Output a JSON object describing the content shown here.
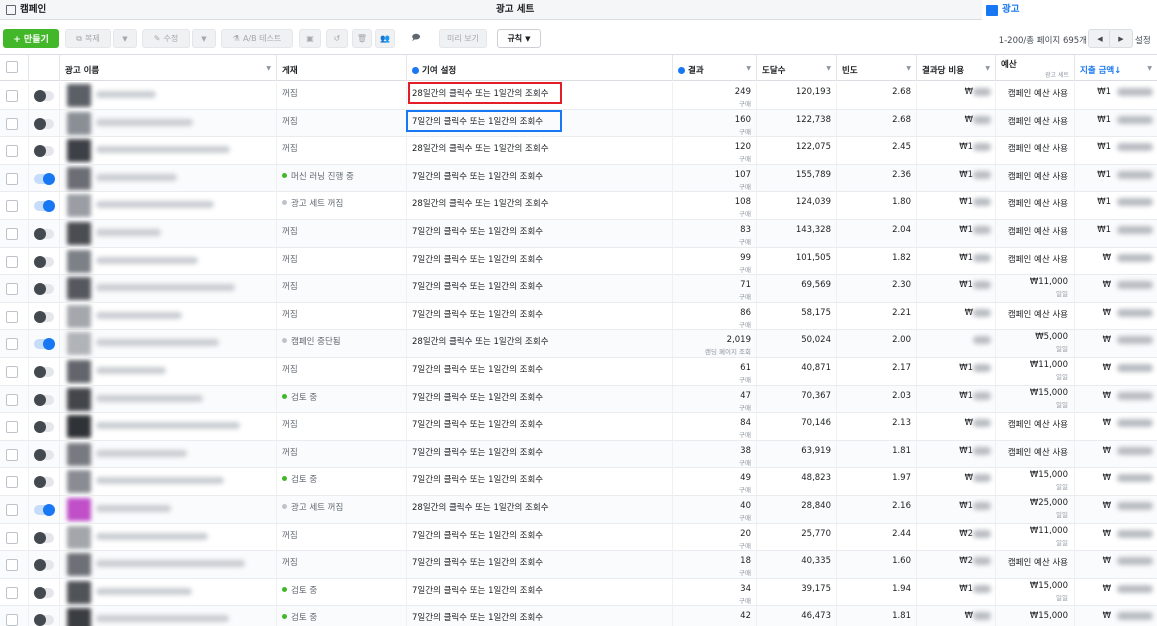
{
  "tabs": {
    "campaign": "캠페인",
    "adset": "광고 세트",
    "ad": "광고"
  },
  "toolbar": {
    "create": "+ 만들기",
    "duplicate": "복제",
    "edit": "수정",
    "ab_test": "A/B 테스트",
    "preview": "미리 보기",
    "rules": "규칙",
    "pagination": "1-200/총 페이지 695개",
    "settings": "설정"
  },
  "columns": {
    "ad_name": "광고 이름",
    "delivery": "게재",
    "attribution": "기여 설정",
    "results": "결과",
    "reach": "도달수",
    "frequency": "빈도",
    "cost_per_result": "결과당 비용",
    "budget": "예산",
    "budget_sub": "광고 세트",
    "amount_spent": "지출 금액"
  },
  "rows": [
    {
      "delivery": "꺼짐",
      "status_dot": "",
      "attribution": "28일간의 클릭수 또는 1일간의 조회수",
      "results": "249",
      "result_type": "구매",
      "reach": "120,193",
      "frequency": "2.68",
      "cpr": "₩",
      "budget": "캠페인 예산 사용",
      "budget_sub": "",
      "spent": "₩1",
      "toggle": "off",
      "thumb": "#5b5f66"
    },
    {
      "delivery": "꺼짐",
      "status_dot": "",
      "attribution": "7일간의 클릭수 또는 1일간의 조회수",
      "results": "160",
      "result_type": "구매",
      "reach": "122,738",
      "frequency": "2.68",
      "cpr": "₩",
      "budget": "캠페인 예산 사용",
      "budget_sub": "",
      "spent": "₩1",
      "toggle": "off",
      "thumb": "#8a8f96"
    },
    {
      "delivery": "꺼짐",
      "status_dot": "",
      "attribution": "28일간의 클릭수 또는 1일간의 조회수",
      "results": "120",
      "result_type": "구매",
      "reach": "122,075",
      "frequency": "2.45",
      "cpr": "₩1",
      "budget": "캠페인 예산 사용",
      "budget_sub": "",
      "spent": "₩1",
      "toggle": "off",
      "thumb": "#3d4046"
    },
    {
      "delivery": "머신 러닝 진행 중",
      "status_dot": "green",
      "attribution": "7일간의 클릭수 또는 1일간의 조회수",
      "results": "107",
      "result_type": "구매",
      "reach": "155,789",
      "frequency": "2.36",
      "cpr": "₩1",
      "budget": "캠페인 예산 사용",
      "budget_sub": "",
      "spent": "₩1",
      "toggle": "on",
      "thumb": "#6b6f75"
    },
    {
      "delivery": "광고 세트 꺼짐",
      "status_dot": "gray",
      "attribution": "28일간의 클릭수 또는 1일간의 조회수",
      "results": "108",
      "result_type": "구매",
      "reach": "124,039",
      "frequency": "1.80",
      "cpr": "₩1",
      "budget": "캠페인 예산 사용",
      "budget_sub": "",
      "spent": "₩1",
      "toggle": "on",
      "thumb": "#9a9ea4"
    },
    {
      "delivery": "꺼짐",
      "status_dot": "",
      "attribution": "7일간의 클릭수 또는 1일간의 조회수",
      "results": "83",
      "result_type": "구매",
      "reach": "143,328",
      "frequency": "2.04",
      "cpr": "₩1",
      "budget": "캠페인 예산 사용",
      "budget_sub": "",
      "spent": "₩1",
      "toggle": "off",
      "thumb": "#4a4d52"
    },
    {
      "delivery": "꺼짐",
      "status_dot": "",
      "attribution": "7일간의 클릭수 또는 1일간의 조회수",
      "results": "99",
      "result_type": "구매",
      "reach": "101,505",
      "frequency": "1.82",
      "cpr": "₩1",
      "budget": "캠페인 예산 사용",
      "budget_sub": "",
      "spent": "₩",
      "toggle": "off",
      "thumb": "#7c8087"
    },
    {
      "delivery": "꺼짐",
      "status_dot": "",
      "attribution": "7일간의 클릭수 또는 1일간의 조회수",
      "results": "71",
      "result_type": "구매",
      "reach": "69,569",
      "frequency": "2.30",
      "cpr": "₩1",
      "budget": "₩11,000",
      "budget_sub": "일일",
      "spent": "₩",
      "toggle": "off",
      "thumb": "#55595f"
    },
    {
      "delivery": "꺼짐",
      "status_dot": "",
      "attribution": "7일간의 클릭수 또는 1일간의 조회수",
      "results": "86",
      "result_type": "구매",
      "reach": "58,175",
      "frequency": "2.21",
      "cpr": "₩",
      "budget": "캠페인 예산 사용",
      "budget_sub": "",
      "spent": "₩",
      "toggle": "off",
      "thumb": "#a4a8ad"
    },
    {
      "delivery": "캠페인 중단됨",
      "status_dot": "gray",
      "attribution": "28일간의 클릭수 또는 1일간의 조회수",
      "results": "2,019",
      "result_type": "랜딩 페이지 조회",
      "reach": "50,024",
      "frequency": "2.00",
      "cpr": "",
      "budget": "₩5,000",
      "budget_sub": "일일",
      "spent": "₩",
      "toggle": "on",
      "thumb": "#b0b3b8"
    },
    {
      "delivery": "꺼짐",
      "status_dot": "",
      "attribution": "7일간의 클릭수 또는 1일간의 조회수",
      "results": "61",
      "result_type": "구매",
      "reach": "40,871",
      "frequency": "2.17",
      "cpr": "₩1",
      "budget": "₩11,000",
      "budget_sub": "일일",
      "spent": "₩",
      "toggle": "off",
      "thumb": "#62666c"
    },
    {
      "delivery": "검토 중",
      "status_dot": "green",
      "attribution": "7일간의 클릭수 또는 1일간의 조회수",
      "results": "47",
      "result_type": "구매",
      "reach": "70,367",
      "frequency": "2.03",
      "cpr": "₩1",
      "budget": "₩15,000",
      "budget_sub": "일일",
      "spent": "₩",
      "toggle": "off",
      "thumb": "#43464b"
    },
    {
      "delivery": "꺼짐",
      "status_dot": "",
      "attribution": "7일간의 클릭수 또는 1일간의 조회수",
      "results": "84",
      "result_type": "구매",
      "reach": "70,146",
      "frequency": "2.13",
      "cpr": "₩",
      "budget": "캠페인 예산 사용",
      "budget_sub": "",
      "spent": "₩",
      "toggle": "off",
      "thumb": "#2f3236"
    },
    {
      "delivery": "꺼짐",
      "status_dot": "",
      "attribution": "7일간의 클릭수 또는 1일간의 조회수",
      "results": "38",
      "result_type": "구매",
      "reach": "63,919",
      "frequency": "1.81",
      "cpr": "₩1",
      "budget": "캠페인 예산 사용",
      "budget_sub": "",
      "spent": "₩",
      "toggle": "off",
      "thumb": "#777b81"
    },
    {
      "delivery": "검토 중",
      "status_dot": "green",
      "attribution": "7일간의 클릭수 또는 1일간의 조회수",
      "results": "49",
      "result_type": "구매",
      "reach": "48,823",
      "frequency": "1.97",
      "cpr": "₩",
      "budget": "₩15,000",
      "budget_sub": "일일",
      "spent": "₩",
      "toggle": "off",
      "thumb": "#898d93"
    },
    {
      "delivery": "광고 세트 꺼짐",
      "status_dot": "gray",
      "attribution": "28일간의 클릭수 또는 1일간의 조회수",
      "results": "40",
      "result_type": "구매",
      "reach": "28,840",
      "frequency": "2.16",
      "cpr": "₩1",
      "budget": "₩25,000",
      "budget_sub": "일일",
      "spent": "₩",
      "toggle": "on",
      "thumb": "#c04fc8"
    },
    {
      "delivery": "꺼짐",
      "status_dot": "",
      "attribution": "7일간의 클릭수 또는 1일간의 조회수",
      "results": "20",
      "result_type": "구매",
      "reach": "25,770",
      "frequency": "2.44",
      "cpr": "₩2",
      "budget": "₩11,000",
      "budget_sub": "일일",
      "spent": "₩",
      "toggle": "off",
      "thumb": "#a3a7ac"
    },
    {
      "delivery": "꺼짐",
      "status_dot": "",
      "attribution": "7일간의 클릭수 또는 1일간의 조회수",
      "results": "18",
      "result_type": "구매",
      "reach": "40,335",
      "frequency": "1.60",
      "cpr": "₩2",
      "budget": "캠페인 예산 사용",
      "budget_sub": "",
      "spent": "₩",
      "toggle": "off",
      "thumb": "#6d7177"
    },
    {
      "delivery": "검토 중",
      "status_dot": "green",
      "attribution": "7일간의 클릭수 또는 1일간의 조회수",
      "results": "34",
      "result_type": "구매",
      "reach": "39,175",
      "frequency": "1.94",
      "cpr": "₩1",
      "budget": "₩15,000",
      "budget_sub": "일일",
      "spent": "₩",
      "toggle": "off",
      "thumb": "#505358"
    },
    {
      "delivery": "검토 중",
      "status_dot": "green",
      "attribution": "7일간의 클릭수 또는 1일간의 조회수",
      "results": "42",
      "result_type": "",
      "reach": "46,473",
      "frequency": "1.81",
      "cpr": "₩",
      "budget": "₩15,000",
      "budget_sub": "",
      "spent": "₩",
      "toggle": "off",
      "thumb": "#3a3d42"
    }
  ]
}
